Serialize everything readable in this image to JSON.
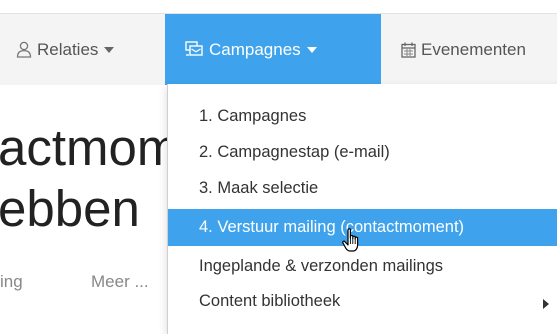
{
  "navbar": {
    "items": [
      {
        "label": "Relaties",
        "icon": "user-icon",
        "has_caret": true,
        "active": false
      },
      {
        "label": "Campagnes",
        "icon": "campaign-icon",
        "has_caret": true,
        "active": true
      },
      {
        "label": "Evenementen",
        "icon": "calendar-icon",
        "has_caret": false,
        "active": false
      }
    ]
  },
  "page": {
    "title_line_1": "actmom",
    "title_line_2": "ebben",
    "tabs": [
      "ing",
      "Meer ..."
    ]
  },
  "dropdown": {
    "items": [
      {
        "label": "1. Campagnes"
      },
      {
        "label": "2. Campagnestap (e-mail)"
      },
      {
        "label": "3. Maak selectie"
      },
      {
        "label": "4. Verstuur mailing (contactmoment)",
        "highlighted": true
      },
      {
        "label": "Ingeplande & verzonden mailings"
      },
      {
        "label": "Content bibliotheek",
        "has_submenu": true
      }
    ]
  },
  "colors": {
    "accent": "#3ea3ec",
    "navbar_bg": "#f4f4f4",
    "text": "#333333"
  }
}
